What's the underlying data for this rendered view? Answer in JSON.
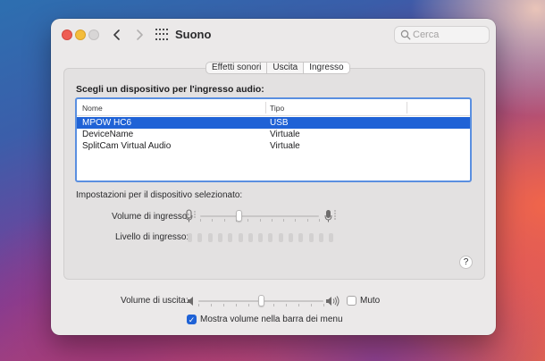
{
  "window": {
    "title": "Suono",
    "search_placeholder": "Cerca"
  },
  "tabs": [
    {
      "label": "Effetti sonori",
      "active": false
    },
    {
      "label": "Uscita",
      "active": false
    },
    {
      "label": "Ingresso",
      "active": true
    }
  ],
  "input": {
    "section_title": "Scegli un dispositivo per l'ingresso audio:",
    "columns": {
      "name": "Nome",
      "type": "Tipo"
    },
    "devices": [
      {
        "name": "MPOW HC6",
        "type": "USB",
        "selected": true
      },
      {
        "name": "DeviceName",
        "type": "Virtuale",
        "selected": false
      },
      {
        "name": "SplitCam Virtual Audio",
        "type": "Virtuale",
        "selected": false
      }
    ],
    "settings_label": "Impostazioni per il dispositivo selezionato:",
    "volume_label": "Volume di ingresso:",
    "volume_fraction": 0.32,
    "level_label": "Livello di ingresso:",
    "level_bars_total": 15,
    "level_bars_lit": 0,
    "help_label": "?"
  },
  "output": {
    "volume_label": "Volume di uscita:",
    "volume_fraction": 0.5,
    "mute_label": "Muto",
    "mute_checked": false,
    "menubar_label": "Mostra volume nella barra dei menu",
    "menubar_checked": true
  },
  "colors": {
    "accent": "#1f62d6",
    "focus_ring": "#5a8fe0",
    "close": "#ee5d53",
    "minimize": "#f4bd3b"
  }
}
